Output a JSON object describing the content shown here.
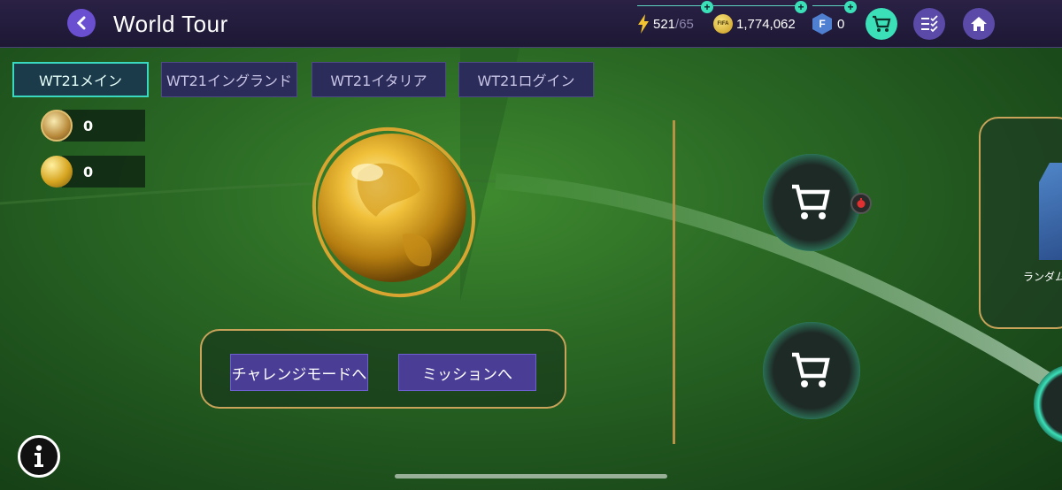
{
  "header": {
    "title": "World Tour",
    "energy": {
      "current": "521",
      "max": "/65"
    },
    "coins": "1,774,062",
    "coin_icon_label": "FIFA",
    "fifa_points": "0",
    "fifa_points_icon_label": "F"
  },
  "tabs": [
    {
      "label": "WT21メイン",
      "active": true
    },
    {
      "label": "WT21イングランド",
      "active": false
    },
    {
      "label": "WT21イタリア",
      "active": false
    },
    {
      "label": "WT21ログイン",
      "active": false
    }
  ],
  "currencies": [
    {
      "icon": "badge-token-icon",
      "value": "0"
    },
    {
      "icon": "gold-ball-icon",
      "value": "0"
    }
  ],
  "actions": {
    "challenge_label": "チャレンジモードへ",
    "mission_label": "ミッションへ"
  },
  "reward_card": {
    "label": "ランダム"
  },
  "colors": {
    "accent": "#3be0b8",
    "tab_bg": "#2c2c5a",
    "button_bg": "#4a3d96",
    "gold": "#c9a35a",
    "topbar": "#1d1834"
  }
}
